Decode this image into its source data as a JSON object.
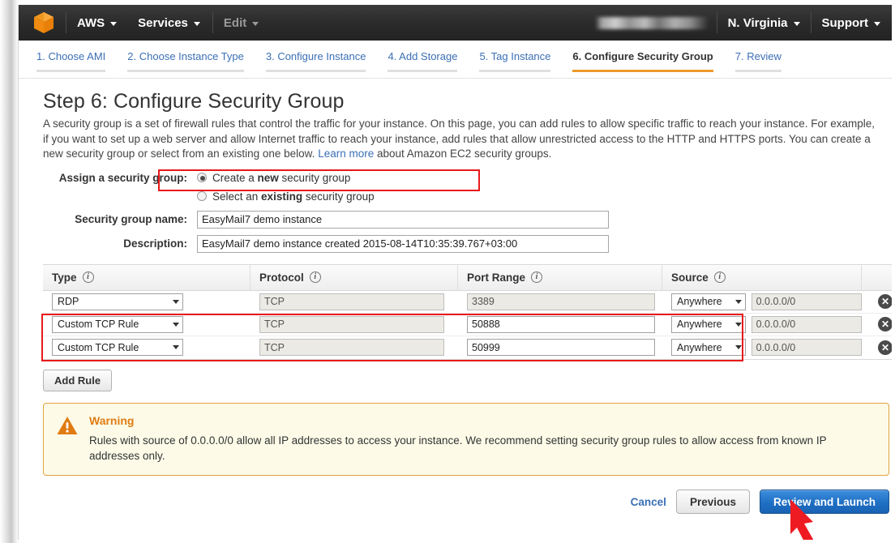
{
  "topbar": {
    "logo_icon": "aws-cube-icon",
    "items": [
      {
        "label": "AWS",
        "icon": "chevron-down-icon",
        "dim": false
      },
      {
        "label": "Services",
        "icon": "chevron-down-icon",
        "dim": false
      },
      {
        "label": "Edit",
        "icon": "chevron-down-icon",
        "dim": true
      }
    ],
    "account_label": "",
    "region": "N. Virginia",
    "support": "Support"
  },
  "tabs": [
    {
      "label": "1. Choose AMI",
      "active": false
    },
    {
      "label": "2. Choose Instance Type",
      "active": false
    },
    {
      "label": "3. Configure Instance",
      "active": false
    },
    {
      "label": "4. Add Storage",
      "active": false
    },
    {
      "label": "5. Tag Instance",
      "active": false
    },
    {
      "label": "6. Configure Security Group",
      "active": true
    },
    {
      "label": "7. Review",
      "active": false
    }
  ],
  "page": {
    "title": "Step 6: Configure Security Group",
    "desc_1": "A security group is a set of firewall rules that control the traffic for your instance. On this page, you can add rules to allow specific traffic to reach your instance. For example, if you want to set up a web server and allow Internet traffic to reach your instance, add rules that allow unrestricted access to the HTTP and HTTPS ports. You can create a new security group or select from an existing one below. ",
    "learn_more": "Learn more",
    "desc_2": " about Amazon EC2 security groups."
  },
  "assign": {
    "label": "Assign a security group:",
    "option_new_pre": "Create a ",
    "option_new_bold": "new",
    "option_new_post": " security group",
    "option_existing_pre": "Select an ",
    "option_existing_bold": "existing",
    "option_existing_post": " security group",
    "selected": "new"
  },
  "fields": {
    "name_label": "Security group name:",
    "name_value": "EasyMail7 demo instance",
    "desc_label": "Description:",
    "desc_value": "EasyMail7 demo instance created 2015-08-14T10:35:39.767+03:00"
  },
  "table": {
    "headers": [
      {
        "label": "Type",
        "icon": "info-icon"
      },
      {
        "label": "Protocol",
        "icon": "info-icon"
      },
      {
        "label": "Port Range",
        "icon": "info-icon"
      },
      {
        "label": "Source",
        "icon": "info-icon"
      }
    ],
    "rows": [
      {
        "type": "RDP",
        "protocol": "TCP",
        "port": "3389",
        "source_select": "Anywhere",
        "source_value": "0.0.0.0/0",
        "port_editable": false,
        "delete_icon": "close-circle-icon"
      },
      {
        "type": "Custom TCP Rule",
        "protocol": "TCP",
        "port": "50888",
        "source_select": "Anywhere",
        "source_value": "0.0.0.0/0",
        "port_editable": true,
        "delete_icon": "close-circle-icon"
      },
      {
        "type": "Custom TCP Rule",
        "protocol": "TCP",
        "port": "50999",
        "source_select": "Anywhere",
        "source_value": "0.0.0.0/0",
        "port_editable": true,
        "delete_icon": "close-circle-icon"
      }
    ],
    "add_rule_label": "Add Rule"
  },
  "warning": {
    "icon": "warning-triangle-icon",
    "title": "Warning",
    "text": "Rules with source of 0.0.0.0/0 allow all IP addresses to access your instance. We recommend setting security group rules to allow access from known IP addresses only."
  },
  "footer": {
    "cancel": "Cancel",
    "previous": "Previous",
    "review_launch": "Review and Launch"
  },
  "annotations": {
    "arrow_icon": "red-arrow-pointer",
    "highlight_color": "#e8191b"
  },
  "colors": {
    "accent_orange": "#eb9b2b",
    "link_blue": "#3b6fb5",
    "primary_button": "#1f6fc4",
    "warning_border": "#e0a33c",
    "warning_bg": "#fdfbe8",
    "topbar_bg": "#2b2b2b"
  }
}
